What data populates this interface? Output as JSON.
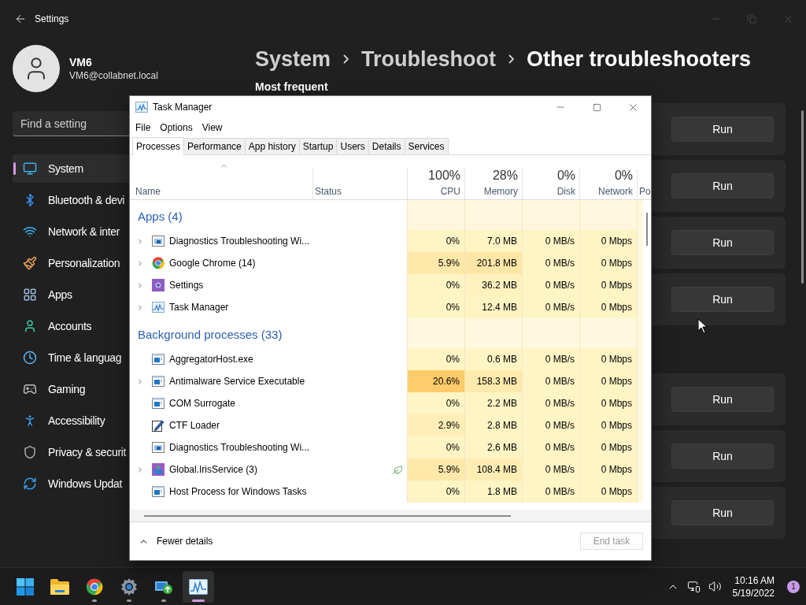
{
  "settings": {
    "title": "Settings",
    "user": {
      "name": "VM6",
      "email": "VM6@collabnet.local"
    },
    "search": {
      "placeholder": "Find a setting"
    },
    "nav": [
      {
        "label": "System",
        "kind": "system",
        "selected": true
      },
      {
        "label": "Bluetooth & devi",
        "kind": "bluetooth",
        "selected": false
      },
      {
        "label": "Network & inter",
        "kind": "network",
        "selected": false
      },
      {
        "label": "Personalization",
        "kind": "brush",
        "selected": false
      },
      {
        "label": "Apps",
        "kind": "apps",
        "selected": false
      },
      {
        "label": "Accounts",
        "kind": "accounts",
        "selected": false
      },
      {
        "label": "Time & languag",
        "kind": "time",
        "selected": false
      },
      {
        "label": "Gaming",
        "kind": "gaming",
        "selected": false
      },
      {
        "label": "Accessibility",
        "kind": "accessibility",
        "selected": false
      },
      {
        "label": "Privacy & securit",
        "kind": "privacy",
        "selected": false
      },
      {
        "label": "Windows Updat",
        "kind": "update",
        "selected": false
      }
    ],
    "breadcrumb": [
      "System",
      "Troubleshoot",
      "Other troubleshooters"
    ],
    "section_heading": "Most frequent",
    "card_groups": [
      {
        "buttons": [
          "Run",
          "Run",
          "Run",
          "Run"
        ]
      },
      {
        "buttons": [
          "Run",
          "Run",
          "Run"
        ]
      }
    ]
  },
  "task_manager": {
    "title": "Task Manager",
    "menu": [
      "File",
      "Options",
      "View"
    ],
    "tabs": [
      {
        "label": "Processes",
        "selected": true
      },
      {
        "label": "Performance",
        "selected": false
      },
      {
        "label": "App history",
        "selected": false
      },
      {
        "label": "Startup",
        "selected": false
      },
      {
        "label": "Users",
        "selected": false
      },
      {
        "label": "Details",
        "selected": false
      },
      {
        "label": "Services",
        "selected": false
      }
    ],
    "columns": [
      {
        "label": "Name",
        "sorted": true
      },
      {
        "label": "Status",
        "sorted": false
      },
      {
        "label": "CPU",
        "usage": "100%",
        "sorted": false
      },
      {
        "label": "Memory",
        "usage": "28%",
        "sorted": false
      },
      {
        "label": "Disk",
        "usage": "0%",
        "sorted": false
      },
      {
        "label": "Network",
        "usage": "0%",
        "sorted": false
      },
      {
        "label": "Po",
        "sorted": false
      }
    ],
    "groups": [
      {
        "title": "Apps (4)",
        "rows": [
          {
            "name": "Diagnostics Troubleshooting Wi...",
            "kind": "diag",
            "expandable": true,
            "efficiency": false,
            "cpu": "0%",
            "memory": "7.0 MB",
            "disk": "0 MB/s",
            "network": "0 Mbps"
          },
          {
            "name": "Google Chrome (14)",
            "kind": "chrome",
            "expandable": true,
            "efficiency": false,
            "cpu": "5.9%",
            "memory": "201.8 MB",
            "disk": "0 MB/s",
            "network": "0 Mbps"
          },
          {
            "name": "Settings",
            "kind": "settings",
            "expandable": true,
            "efficiency": false,
            "cpu": "0%",
            "memory": "36.2 MB",
            "disk": "0 MB/s",
            "network": "0 Mbps"
          },
          {
            "name": "Task Manager",
            "kind": "taskmgr",
            "expandable": true,
            "efficiency": false,
            "cpu": "0%",
            "memory": "12.4 MB",
            "disk": "0 MB/s",
            "network": "0 Mbps"
          }
        ]
      },
      {
        "title": "Background processes (33)",
        "rows": [
          {
            "name": "AggregatorHost.exe",
            "kind": "exe",
            "expandable": false,
            "efficiency": false,
            "cpu": "0%",
            "memory": "0.6 MB",
            "disk": "0 MB/s",
            "network": "0 Mbps"
          },
          {
            "name": "Antimalware Service Executable",
            "kind": "exe",
            "expandable": true,
            "efficiency": false,
            "cpu": "20.6%",
            "memory": "158.3 MB",
            "disk": "0 MB/s",
            "network": "0 Mbps"
          },
          {
            "name": "COM Surrogate",
            "kind": "exe",
            "expandable": false,
            "efficiency": false,
            "cpu": "0%",
            "memory": "2.2 MB",
            "disk": "0 MB/s",
            "network": "0 Mbps"
          },
          {
            "name": "CTF Loader",
            "kind": "ctf",
            "expandable": false,
            "efficiency": false,
            "cpu": "2.9%",
            "memory": "2.8 MB",
            "disk": "0 MB/s",
            "network": "0 Mbps"
          },
          {
            "name": "Diagnostics Troubleshooting Wi...",
            "kind": "diag",
            "expandable": false,
            "efficiency": false,
            "cpu": "0%",
            "memory": "2.6 MB",
            "disk": "0 MB/s",
            "network": "0 Mbps"
          },
          {
            "name": "Global.IrisService (3)",
            "kind": "iris",
            "expandable": true,
            "efficiency": true,
            "cpu": "5.9%",
            "memory": "108.4 MB",
            "disk": "0 MB/s",
            "network": "0 Mbps"
          },
          {
            "name": "Host Process for Windows Tasks",
            "kind": "exe",
            "expandable": false,
            "efficiency": false,
            "cpu": "0%",
            "memory": "1.8 MB",
            "disk": "0 MB/s",
            "network": "0 Mbps"
          }
        ]
      }
    ],
    "footer": {
      "toggle": "Fewer details",
      "end_task": {
        "label": "End task",
        "disabled": true
      }
    }
  },
  "taskbar": {
    "apps": [
      {
        "kind": "start",
        "running": false,
        "active": false
      },
      {
        "kind": "folder",
        "running": false,
        "active": false
      },
      {
        "kind": "chrome",
        "running": true,
        "active": false
      },
      {
        "kind": "settings",
        "running": true,
        "active": false
      },
      {
        "kind": "remote",
        "running": true,
        "active": false
      },
      {
        "kind": "taskmgr",
        "running": true,
        "active": true
      }
    ],
    "time": "10:16 AM",
    "date": "5/19/2022",
    "notifications": "1"
  }
}
